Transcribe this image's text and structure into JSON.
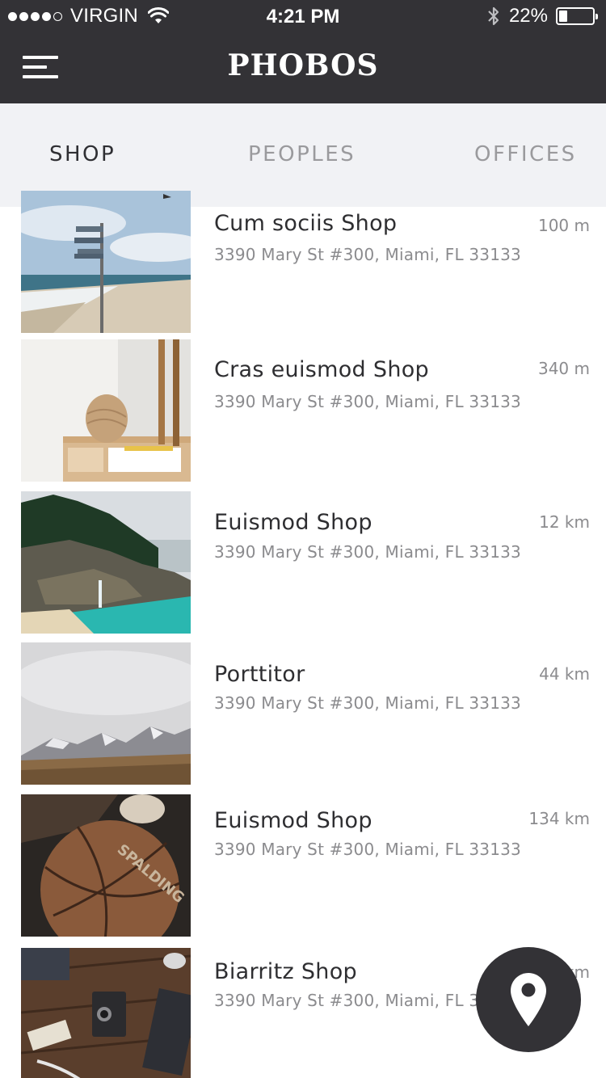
{
  "status_bar": {
    "carrier": "VIRGIN",
    "time": "4:21 PM",
    "battery": "22%",
    "battery_level": 0.22,
    "signal_bars_filled": 4,
    "signal_bars_total": 5
  },
  "header": {
    "title": "PHOBOS",
    "menu_icon": "hamburger-menu-icon"
  },
  "tabs": [
    {
      "label": "SHOP",
      "active": true
    },
    {
      "label": "PEOPLES",
      "active": false
    },
    {
      "label": "OFFICES",
      "active": false
    }
  ],
  "items": [
    {
      "name": "Cum sociis Shop",
      "address": "3390 Mary St #300, Miami, FL 33133",
      "distance": "100 m"
    },
    {
      "name": "Cras euismod Shop",
      "address": "3390 Mary St #300, Miami, FL 33133",
      "distance": "340 m"
    },
    {
      "name": "Euismod Shop",
      "address": "3390 Mary St #300, Miami, FL 33133",
      "distance": "12 km"
    },
    {
      "name": "Porttitor",
      "address": "3390 Mary St #300, Miami, FL 33133",
      "distance": "44 km"
    },
    {
      "name": "Euismod Shop",
      "address": "3390 Mary St #300, Miami, FL 33133",
      "distance": "134 km"
    },
    {
      "name": "Biarritz Shop",
      "address": "3390 Mary St #300, Miami, FL 33133",
      "distance": "km"
    }
  ],
  "fab": {
    "icon": "map-pin-icon"
  },
  "colors": {
    "header_bg": "#333236",
    "tabs_bg": "#f1f2f5",
    "text_dark": "#2e2e31",
    "text_muted": "#8b8b8e"
  }
}
